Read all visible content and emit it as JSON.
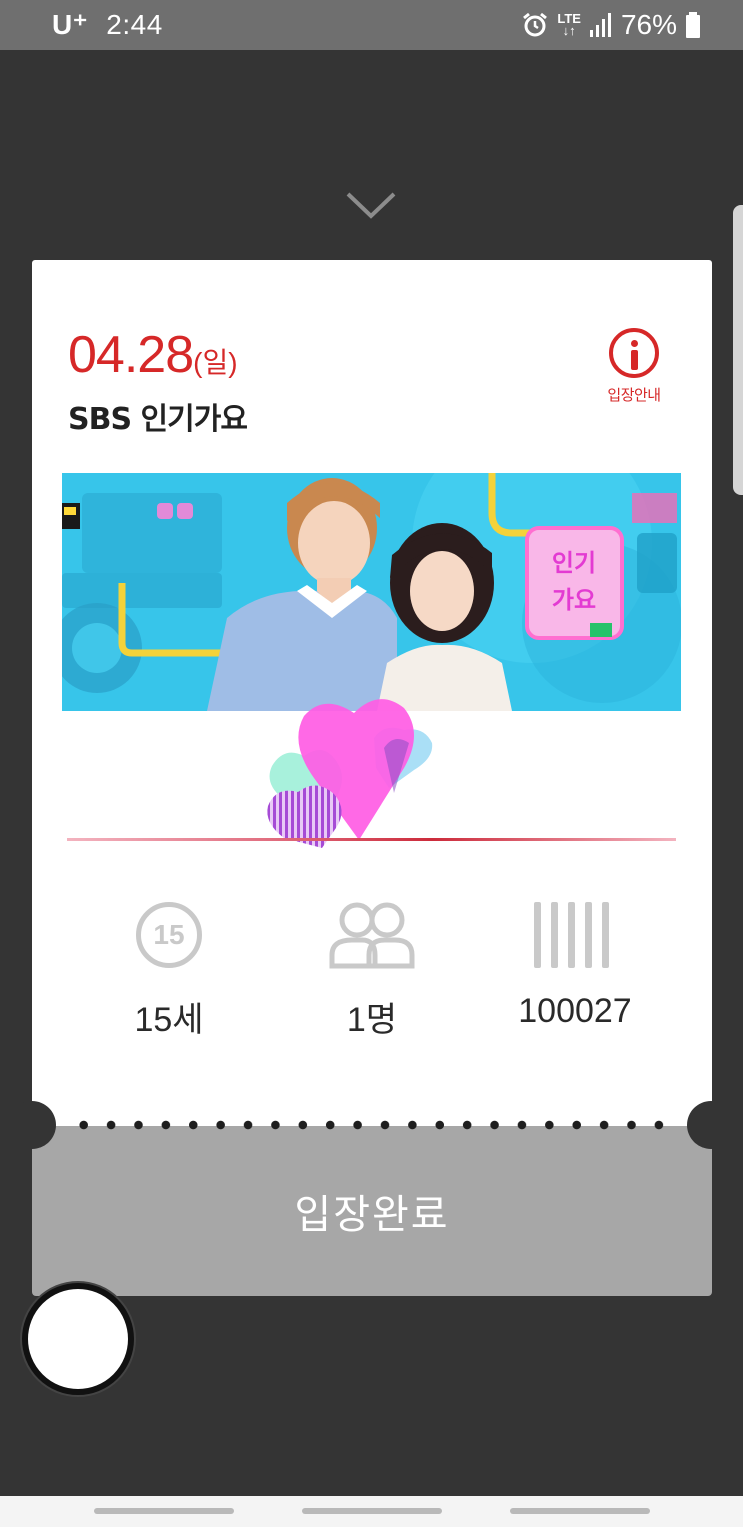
{
  "status_bar": {
    "carrier": "U⁺",
    "time": "2:44",
    "network": "LTE",
    "battery": "76%"
  },
  "ticket": {
    "date": "04.28",
    "day": "(일)",
    "show_title": "SBS 인기가요",
    "info_label": "입장안내",
    "banner_logo_text": "인기가요",
    "stats": {
      "age": "15세",
      "age_badge": "15",
      "people": "1명",
      "code": "100027"
    },
    "stub_label": "입장완료"
  },
  "colors": {
    "accent": "#d62828",
    "background": "#343434",
    "stub": "#a7a7a7"
  }
}
